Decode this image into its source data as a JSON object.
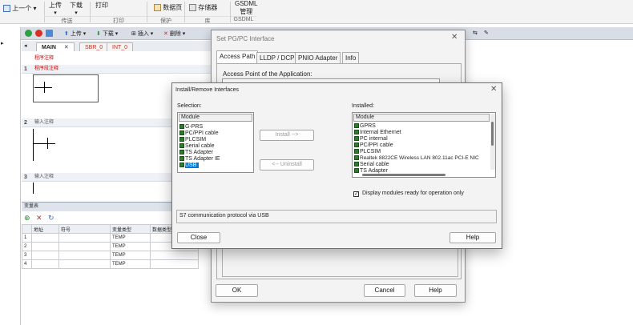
{
  "ribbon": {
    "prev": "上一个",
    "upload": "上传",
    "download": "下载",
    "print": "打印",
    "data_page": "数据页",
    "memory": "存储器",
    "gsdml_top": "GSDML",
    "gsdml_manage": "管理",
    "groups": [
      "传送",
      "打印",
      "保护",
      "库",
      "GSDML"
    ]
  },
  "editor_toolbar": {
    "upload": "上传",
    "download": "下载",
    "insert": "插入",
    "delete": "删除"
  },
  "program_tabs": [
    "MAIN",
    "SBR_0",
    "INT_0"
  ],
  "ladder": {
    "program_comment": "程序注释",
    "networks": [
      {
        "num": "1",
        "comment": "程序段注释"
      },
      {
        "num": "2",
        "comment": "输入注释"
      },
      {
        "num": "3",
        "comment": "输入注释"
      }
    ]
  },
  "symbol_table": {
    "title": "变量表",
    "columns": [
      "地址",
      "符号",
      "变量类型",
      "数据类型"
    ],
    "rows": [
      {
        "num": "1",
        "type": "TEMP"
      },
      {
        "num": "2",
        "type": "TEMP"
      },
      {
        "num": "3",
        "type": "TEMP"
      },
      {
        "num": "4",
        "type": "TEMP"
      }
    ]
  },
  "pgpc_dialog": {
    "title": "Set PG/PC Interface",
    "tabs": [
      "Access Path",
      "LLDP / DCP",
      "PNIO Adapter",
      "Info"
    ],
    "access_point_label": "Access Point of the Application:",
    "ok": "OK",
    "cancel": "Cancel",
    "help": "Help"
  },
  "install_dialog": {
    "title": "Install/Remove Interfaces",
    "selection_label": "Selection:",
    "installed_label": "Installed:",
    "module_header": "Module",
    "selection_items": [
      "G-PRS",
      "PC/PPI cable",
      "PLCSIM",
      "Serial cable",
      "TS Adapter",
      "TS Adapter IE",
      "USB"
    ],
    "selected_item": "USB",
    "installed_items": [
      "GPRS",
      "Internal Ethernet",
      "PC internal",
      "PC/PPI cable",
      "PLCSIM",
      "Realtek 8822CE Wireless LAN 802.11ac PCI-E NIC",
      "Serial cable",
      "TS Adapter"
    ],
    "install_button": "Install -->",
    "uninstall_button": "<-- Uninstall",
    "display_check_label": "Display modules ready for operation only",
    "display_checked": true,
    "status_text": "S7 communication protocol via USB",
    "close": "Close",
    "help": "Help"
  },
  "colors": {
    "selection_blue": "#0078d7",
    "ladder_comment_red": "#c00000"
  }
}
